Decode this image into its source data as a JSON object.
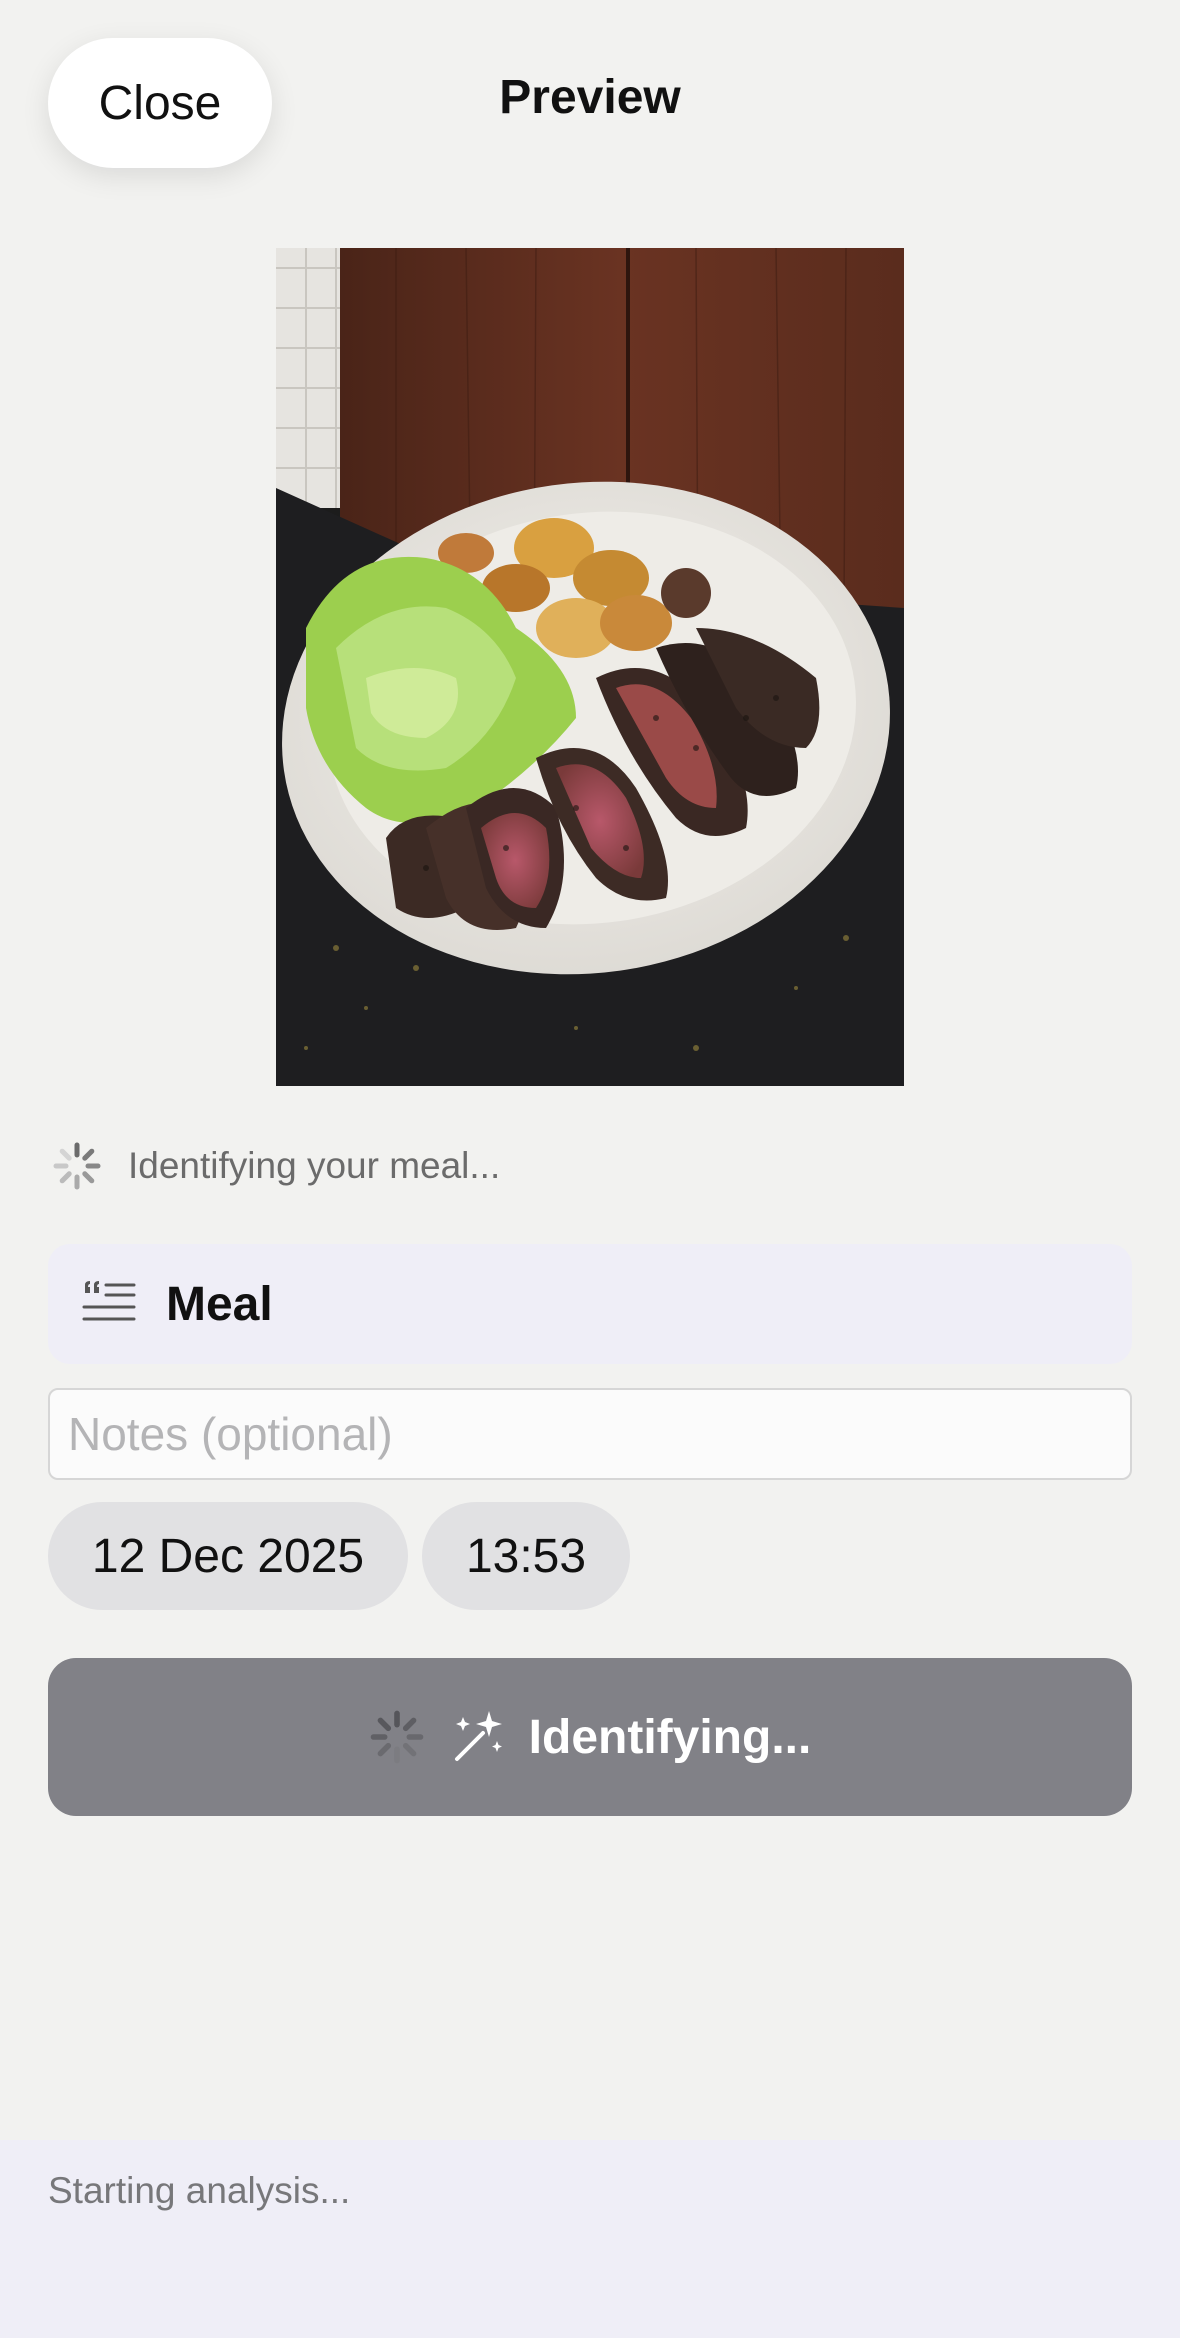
{
  "header": {
    "close_label": "Close",
    "title": "Preview"
  },
  "photo": {
    "description_icon": "meal-photo"
  },
  "status": {
    "text": "Identifying your meal..."
  },
  "meal": {
    "icon": "text-quote-icon",
    "label": "Meal"
  },
  "notes": {
    "placeholder": "Notes (optional)",
    "value": ""
  },
  "datetime": {
    "date": "12 Dec 2025",
    "time": "13:53"
  },
  "identify_button": {
    "label": "Identifying...",
    "icons": [
      "spinner-icon",
      "magic-wand-icon"
    ]
  },
  "footer": {
    "text": "Starting analysis..."
  },
  "colors": {
    "background": "#f2f2f0",
    "card": "#efeef7",
    "button_disabled": "#818187",
    "pill": "#e1e1e3"
  }
}
